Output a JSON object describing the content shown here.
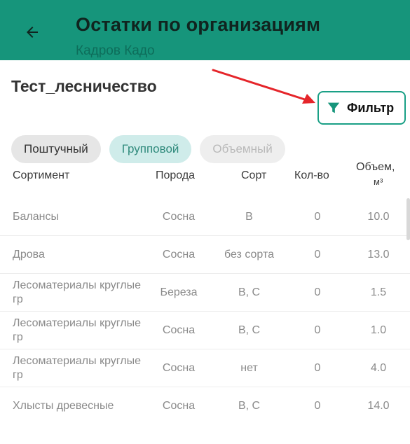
{
  "appbar": {
    "back_icon": "arrow-left-icon",
    "title": "Остатки по организациям",
    "subtitle": "Кадров Кадо",
    "color": "#16957b"
  },
  "organization": "Тест_лесничество",
  "filter": {
    "label": "Фильтр",
    "icon": "filter-funnel-icon",
    "accent": "#1aa086"
  },
  "annotation": {
    "icon": "red-arrow-icon",
    "color": "#e5252a"
  },
  "tabs": [
    {
      "label": "Поштучный",
      "state": "inactive"
    },
    {
      "label": "Групповой",
      "state": "selected"
    },
    {
      "label": "Объемный",
      "state": "disabled"
    }
  ],
  "table": {
    "headers": {
      "sortiment": "Сортимент",
      "poroda": "Порода",
      "sort": "Сорт",
      "qty": "Кол-во",
      "volume_line1": "Объем,",
      "volume_line2": "м³"
    },
    "rows": [
      {
        "sortiment": "Балансы",
        "poroda": "Сосна",
        "sort": "B",
        "qty": "0",
        "volume": "10.0"
      },
      {
        "sortiment": "Дрова",
        "poroda": "Сосна",
        "sort": "без сорта",
        "qty": "0",
        "volume": "13.0"
      },
      {
        "sortiment": "Лесоматериалы круглые гр",
        "poroda": "Береза",
        "sort": "B, C",
        "qty": "0",
        "volume": "1.5"
      },
      {
        "sortiment": "Лесоматериалы круглые гр",
        "poroda": "Сосна",
        "sort": "B, C",
        "qty": "0",
        "volume": "1.0"
      },
      {
        "sortiment": "Лесоматериалы круглые гр",
        "poroda": "Сосна",
        "sort": "нет",
        "qty": "0",
        "volume": "4.0"
      },
      {
        "sortiment": "Хлысты древесные",
        "poroda": "Сосна",
        "sort": "B, C",
        "qty": "0",
        "volume": "14.0"
      }
    ]
  }
}
